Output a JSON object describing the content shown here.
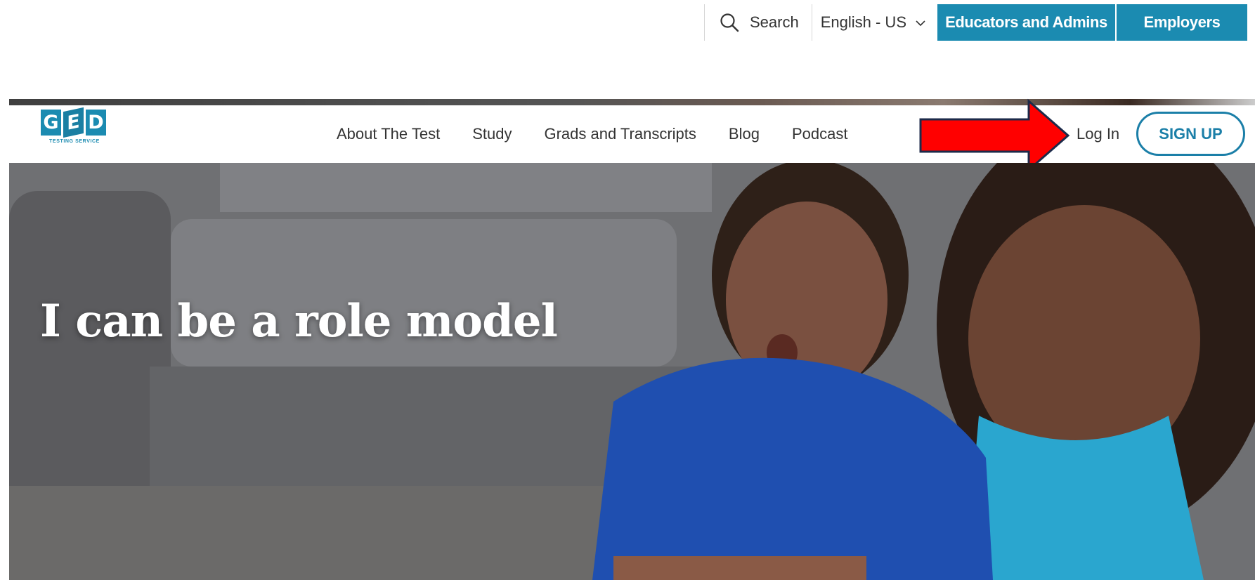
{
  "utility": {
    "search_label": "Search",
    "language_label": "English - US",
    "educators_label": "Educators and Admins",
    "employers_label": "Employers"
  },
  "logo": {
    "letters": [
      "G",
      "E",
      "D"
    ],
    "tagline": "TESTING SERVICE"
  },
  "nav": {
    "items": [
      {
        "label": "About The Test"
      },
      {
        "label": "Study"
      },
      {
        "label": "Grads and Transcripts"
      },
      {
        "label": "Blog"
      },
      {
        "label": "Podcast"
      }
    ],
    "login_label": "Log In",
    "signup_label": "SIGN UP"
  },
  "hero": {
    "title": "I can be a role model"
  },
  "colors": {
    "brand_blue": "#1b8bb1",
    "annotation_red": "#ff0000"
  },
  "icons": {
    "search": "search-icon",
    "language_dropdown": "chevron-down-icon",
    "annotation": "red-arrow-icon"
  }
}
